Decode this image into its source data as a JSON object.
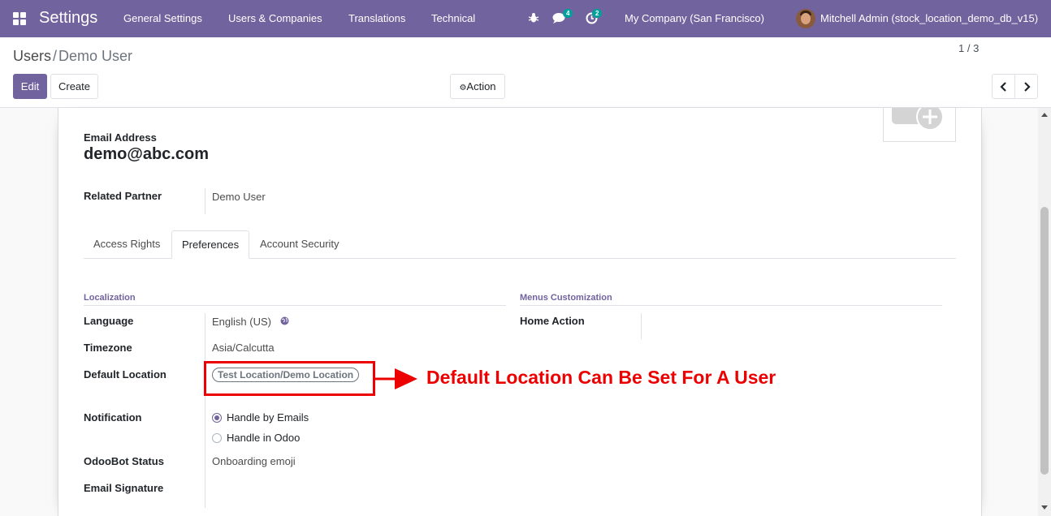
{
  "navbar": {
    "brand": "Settings",
    "menu": [
      "General Settings",
      "Users & Companies",
      "Translations",
      "Technical"
    ],
    "messages_count": "4",
    "activities_count": "2",
    "company": "My Company (San Francisco)",
    "user": "Mitchell Admin (stock_location_demo_db_v15)",
    "icons": [
      "apps-grid-icon",
      "debug-bug-icon",
      "chat-icon",
      "activity-clock-icon"
    ]
  },
  "breadcrumb": {
    "parent": "Users",
    "separator": "/",
    "current": "Demo User"
  },
  "toolbar": {
    "edit": "Edit",
    "create": "Create",
    "action": "Action"
  },
  "pager": {
    "value": "1 / 3"
  },
  "form": {
    "email_label": "Email Address",
    "email_value": "demo@abc.com",
    "partner_label": "Related Partner",
    "partner_value": "Demo User",
    "tabs": [
      "Access Rights",
      "Preferences",
      "Account Security"
    ],
    "active_tab": "Preferences",
    "localization": {
      "title": "Localization",
      "language_label": "Language",
      "language_value": "English (US)",
      "timezone_label": "Timezone",
      "timezone_value": "Asia/Calcutta",
      "default_location_label": "Default Location",
      "default_location_value": "Test Location/Demo Location"
    },
    "menus": {
      "title": "Menus Customization",
      "home_action_label": "Home Action"
    },
    "notification": {
      "label": "Notification",
      "options": [
        "Handle by Emails",
        "Handle in Odoo"
      ],
      "selected": "Handle by Emails"
    },
    "odoobot_label": "OdooBot Status",
    "odoobot_value": "Onboarding emoji",
    "signature_label": "Email Signature"
  },
  "annotation": {
    "text": "Default Location Can Be Set For A User",
    "color": "#ec0000"
  },
  "colors": {
    "brand": "#71639e",
    "badge": "#00a09d"
  }
}
